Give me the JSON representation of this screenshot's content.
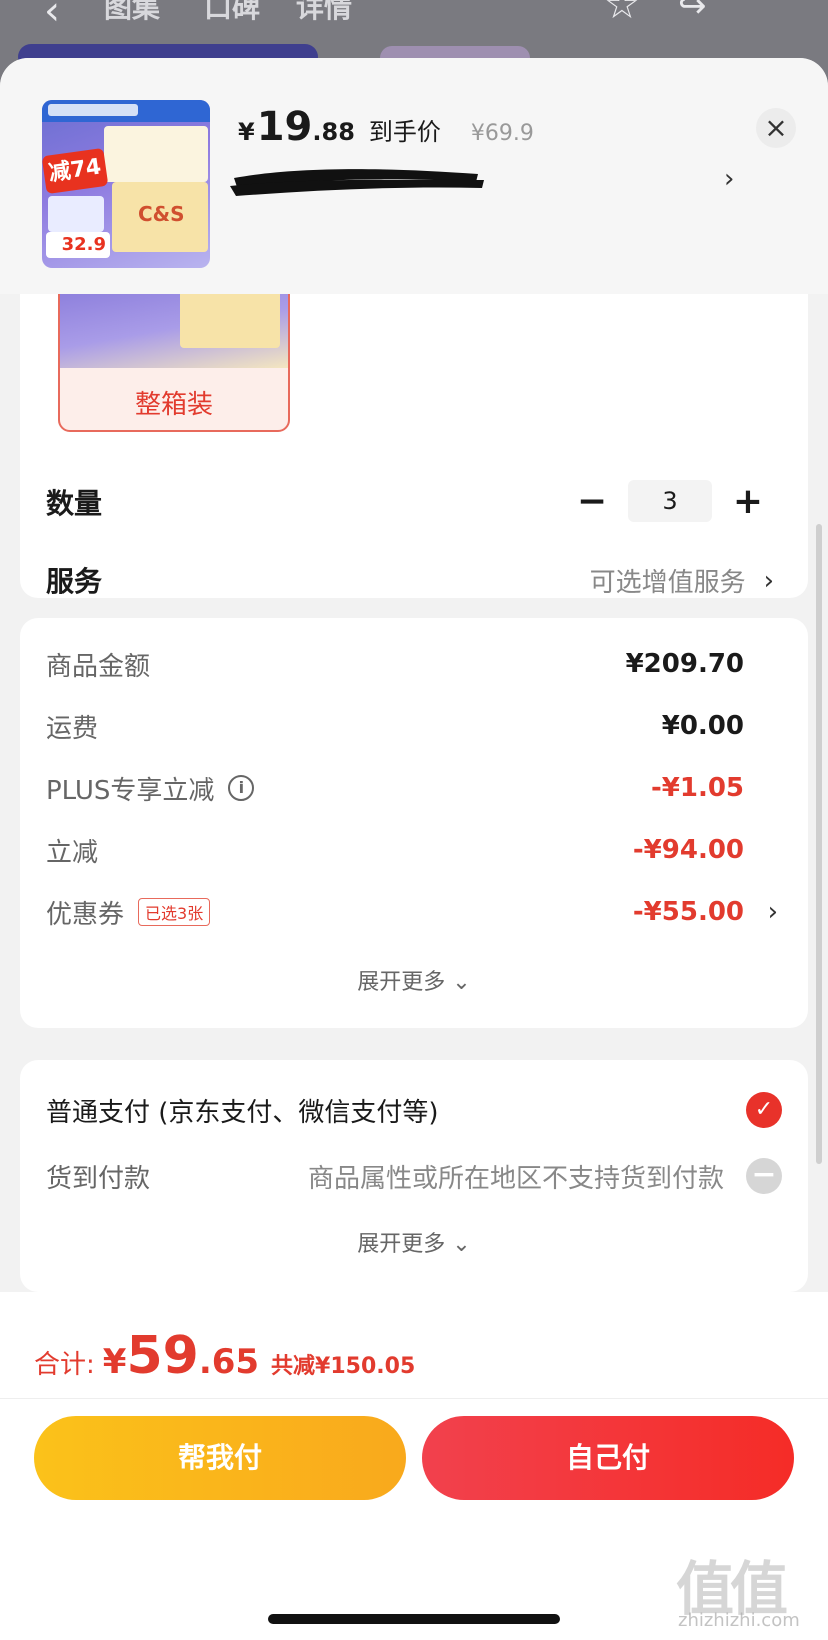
{
  "background_nav": {
    "tabs": [
      "图集",
      "口碑",
      "详情"
    ]
  },
  "product": {
    "thumb_tag": "减74",
    "thumb_brand": "C&S",
    "thumb_price": "32.9",
    "price_currency": "¥",
    "price_int": "19",
    "price_dec": ".88",
    "price_tag": "到手价",
    "original_price": "¥69.9"
  },
  "spec": {
    "selected_label": "整箱装"
  },
  "quantity": {
    "label": "数量",
    "minus": "−",
    "value": "3",
    "plus": "+"
  },
  "service": {
    "label": "服务",
    "value": "可选增值服务"
  },
  "amounts": {
    "goods_label": "商品金额",
    "goods_value": "¥209.70",
    "shipping_label": "运费",
    "shipping_value": "¥0.00",
    "plus_label": "PLUS专享立减",
    "plus_value": "-¥1.05",
    "instant_label": "立减",
    "instant_value": "-¥94.00",
    "coupon_label": "优惠券",
    "coupon_badge": "已选3张",
    "coupon_value": "-¥55.00",
    "expand": "展开更多"
  },
  "payment": {
    "normal_label": "普通支付 (京东支付、微信支付等)",
    "cod_label": "货到付款",
    "cod_note": "商品属性或所在地区不支持货到付款",
    "expand": "展开更多"
  },
  "footer": {
    "total_label": "合计:",
    "total_currency": "¥",
    "total_int": "59",
    "total_dec": ".65",
    "total_save": "共减¥150.05",
    "help_pay": "帮我付",
    "self_pay": "自己付"
  },
  "watermark": {
    "main": "值值值",
    "sub": "zhizhizhi.com"
  },
  "colors": {
    "accent_red": "#e23b2e",
    "help_yellow": "#fbc21a",
    "self_red": "#f2414d"
  }
}
